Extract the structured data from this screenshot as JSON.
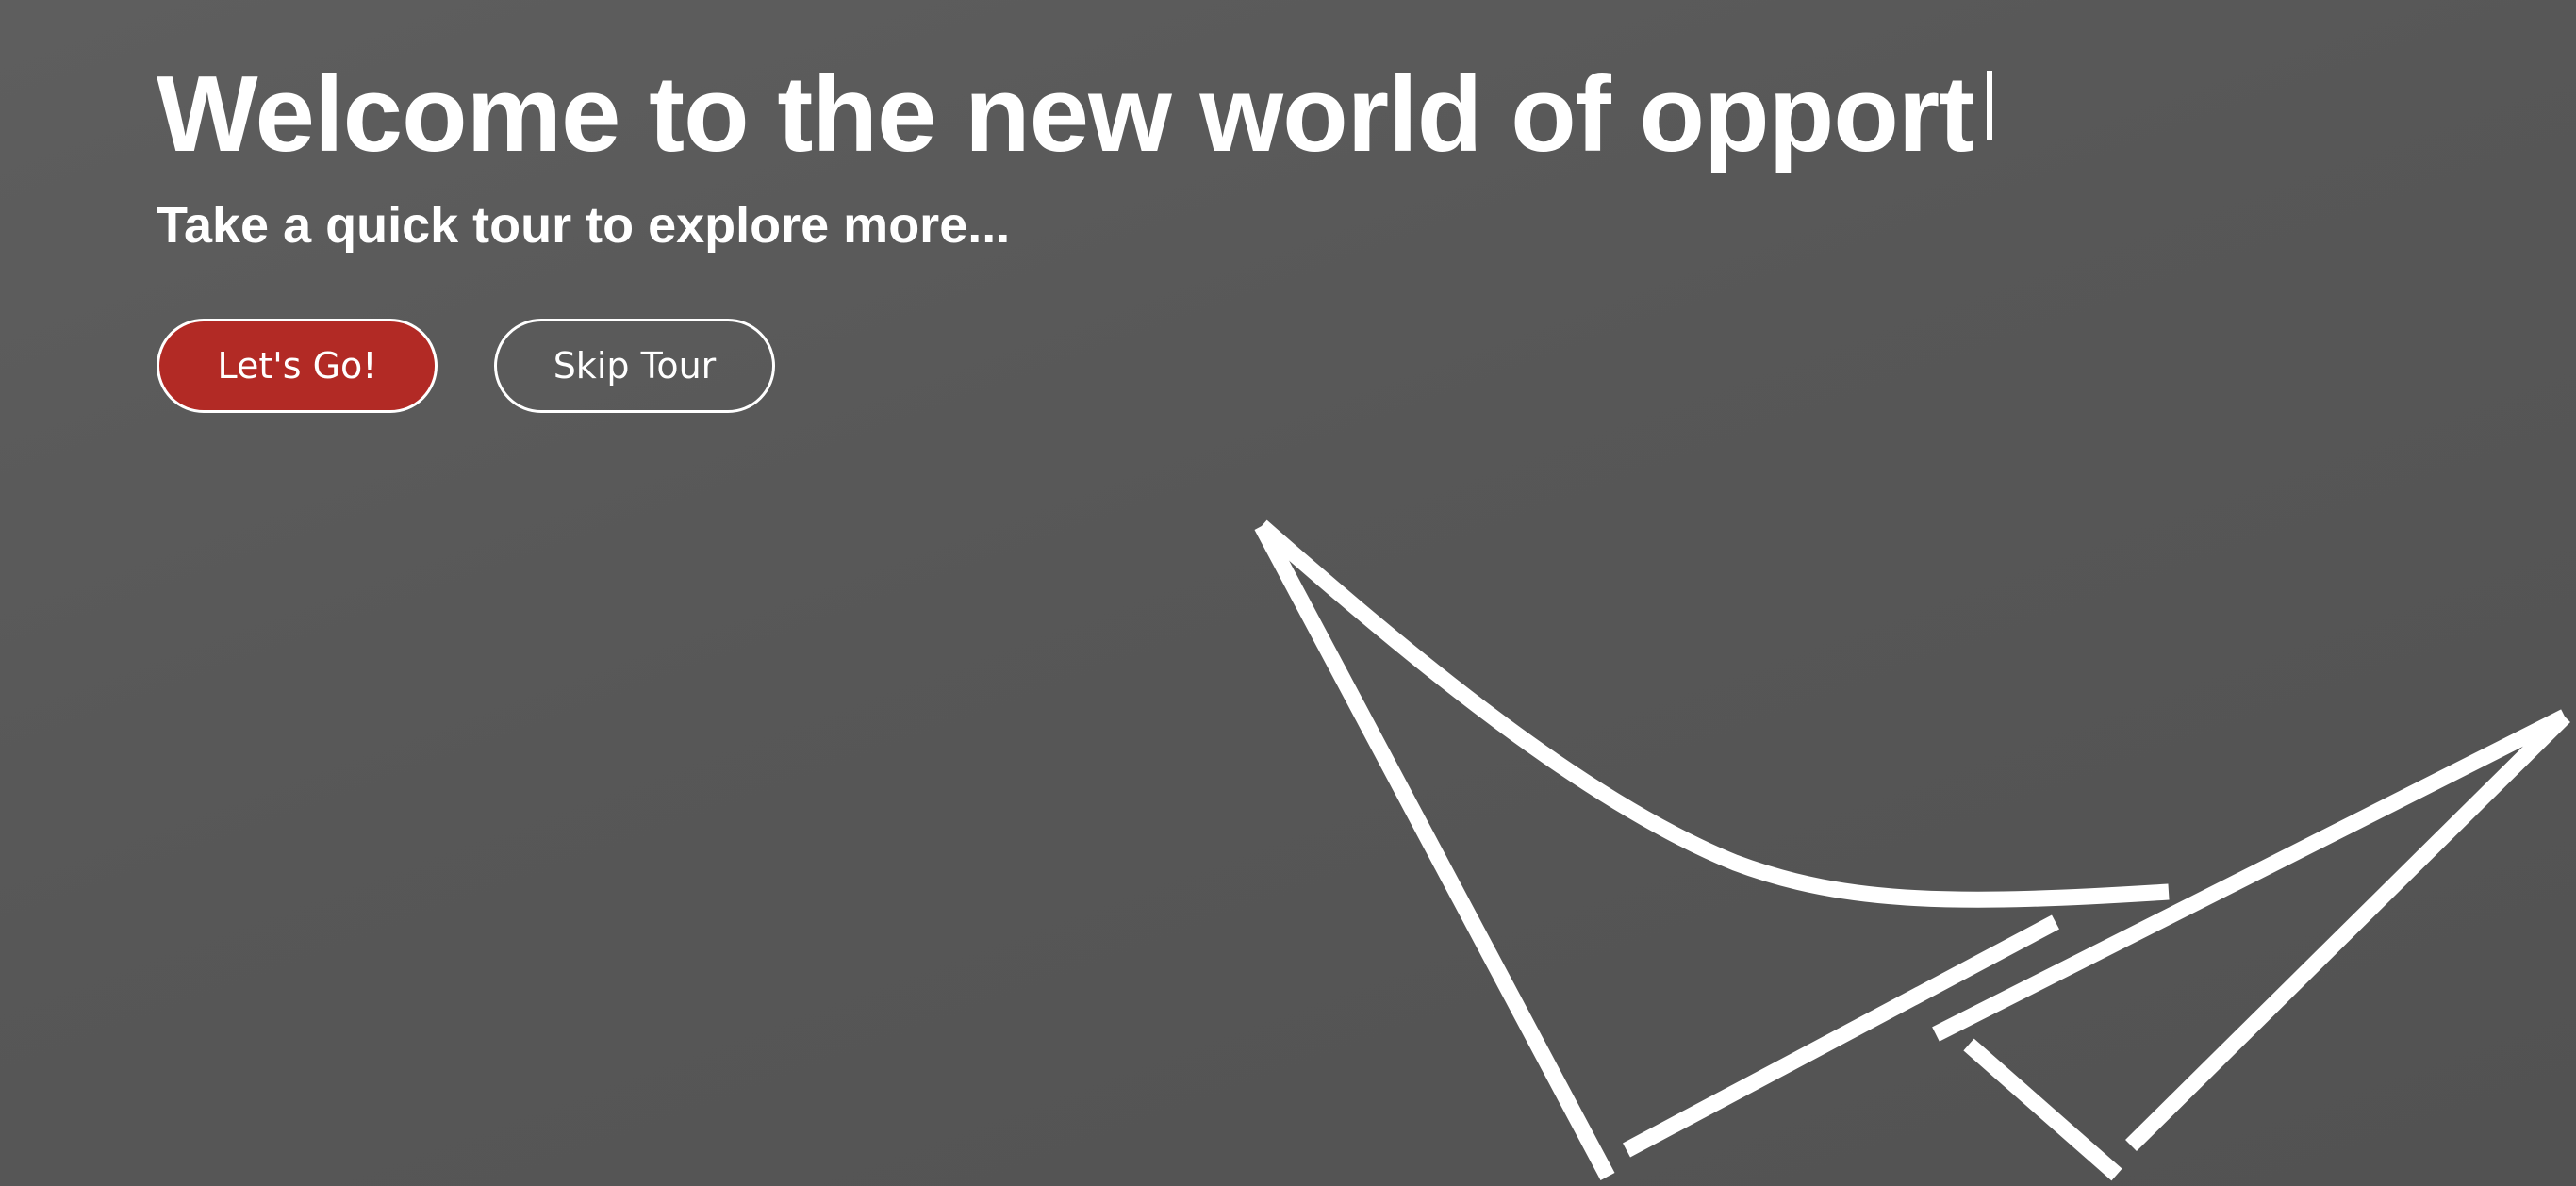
{
  "hero": {
    "headline": "Welcome to the new world of opport",
    "subheadline": "Take a quick tour to explore more..."
  },
  "actions": {
    "start_label": "Let's Go!",
    "skip_label": "Skip Tour"
  },
  "colors": {
    "background": "#595959",
    "primary_button": "#b22a25",
    "foreground": "#ffffff"
  },
  "decoration": {
    "logo_icon": "paper-sail-logo-icon"
  }
}
